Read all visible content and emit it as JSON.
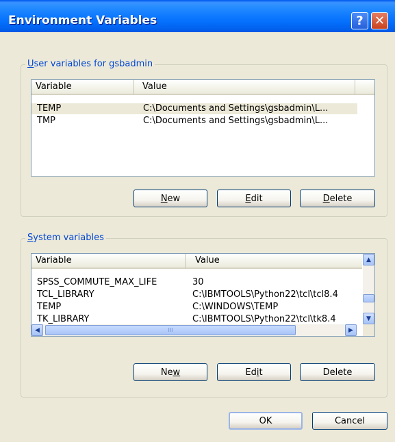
{
  "window": {
    "title": "Environment Variables",
    "help_glyph": "?",
    "close_glyph": "✕"
  },
  "user_section": {
    "legend_hot": "U",
    "legend_rest": "ser variables for gsbadmin",
    "headers": [
      "Variable",
      "Value"
    ],
    "rows": [
      {
        "variable": "TEMP",
        "value": "C:\\Documents and Settings\\gsbadmin\\L..."
      },
      {
        "variable": "TMP",
        "value": "C:\\Documents and Settings\\gsbadmin\\L..."
      }
    ],
    "new_hot": "N",
    "new_rest": "ew",
    "edit_pre": "",
    "edit_hot": "E",
    "edit_rest": "dit",
    "delete_hot": "D",
    "delete_rest": "elete"
  },
  "system_section": {
    "legend_hot": "S",
    "legend_rest": "ystem variables",
    "headers": [
      "Variable",
      "Value"
    ],
    "rows": [
      {
        "variable": "SPSS_COMMUTE_MAX_LIFE",
        "value": "30"
      },
      {
        "variable": "TCL_LIBRARY",
        "value": "C:\\IBMTOOLS\\Python22\\tcl\\tcl8.4"
      },
      {
        "variable": "TEMP",
        "value": "C:\\WINDOWS\\TEMP"
      },
      {
        "variable": "TK_LIBRARY",
        "value": "C:\\IBMTOOLS\\Python22\\tcl\\tk8.4"
      }
    ],
    "new_pre": "Ne",
    "new_hot": "w",
    "new_rest": "",
    "edit_pre": "Ed",
    "edit_hot": "i",
    "edit_rest": "t",
    "delete_pre": "Delete"
  },
  "footer": {
    "ok_label": "OK",
    "cancel_label": "Cancel"
  },
  "scrollbar": {
    "up_glyph": "▲",
    "down_glyph": "▼",
    "left_glyph": "◀",
    "right_glyph": "▶",
    "thumb_grip": "III"
  }
}
